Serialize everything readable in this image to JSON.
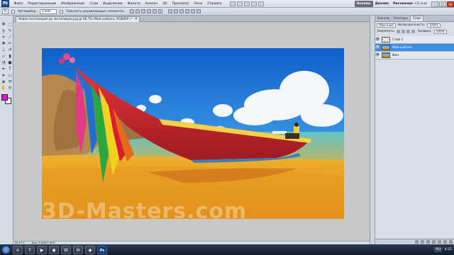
{
  "menubar": {
    "logo": "Ps",
    "items": [
      "Файл",
      "Редактирование",
      "Изображение",
      "Слои",
      "Выделение",
      "Фильтр",
      "Анализ",
      "3D",
      "Просмотр",
      "Окно",
      "Справка"
    ],
    "workspaces": [
      "Основы",
      "Дизайн",
      "Рисование"
    ],
    "cs_live": "CS Live",
    "window_controls": [
      "–",
      "□",
      "✕"
    ]
  },
  "options": {
    "tool": "↖",
    "autoselect_label": "Автовыбор:",
    "autoselect_value": "Слой",
    "transform_label": "Показать управляющие элементы"
  },
  "document": {
    "tab_title": "Новая экспозиция до экспозиции.jpg @ 66,7% (Мой шаблон, RGB/8#) *",
    "close": "✕"
  },
  "watermark": "3D-Masters.com",
  "statusbar": {
    "zoom": "66,67%",
    "doc_info": "Док: 3,83M/7,65M"
  },
  "layers_panel": {
    "tabs": [
      "Слои",
      "Каналы",
      "Контуры"
    ],
    "blend_mode": "Обычные",
    "opacity_label": "Непрозрачность:",
    "opacity_value": "100%",
    "lock_label": "Закрепить:",
    "fill_label": "Заливка:",
    "fill_value": "100%",
    "layers": [
      {
        "name": "Слой 1",
        "selected": false,
        "thumb": "empty"
      },
      {
        "name": "Мой шаблон",
        "selected": true,
        "thumb": "photo"
      },
      {
        "name": "Фон",
        "selected": false,
        "thumb": "photo"
      }
    ]
  },
  "taskbar": {
    "apps": [
      "e",
      "Y",
      "▶",
      "◉",
      "W",
      "✉",
      "◆",
      "Ps"
    ],
    "lang": "RU",
    "time": "4:21"
  },
  "colors": {
    "foreground": "#ff00ff",
    "background": "#ffffff",
    "selection": "#3d8ee6"
  }
}
